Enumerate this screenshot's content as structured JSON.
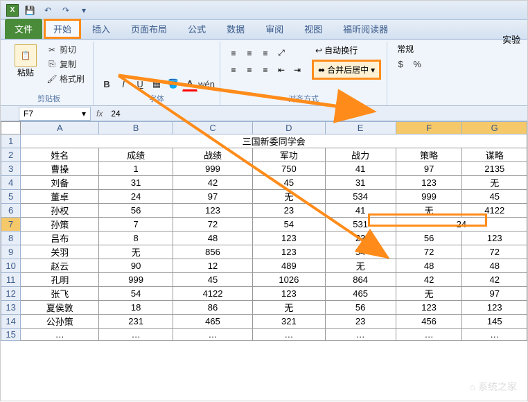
{
  "qat": {
    "app_icon": "X",
    "save": "💾",
    "undo": "↶",
    "redo": "↷"
  },
  "exp_label": "实验",
  "tabs": {
    "file": "文件",
    "home": "开始",
    "insert": "插入",
    "layout": "页面布局",
    "formula": "公式",
    "data": "数据",
    "review": "审阅",
    "view": "视图",
    "foxit": "福昕阅读器"
  },
  "ribbon": {
    "clipboard": {
      "paste": "粘贴",
      "cut": "剪切",
      "copy": "复制",
      "format_painter": "格式刷",
      "label": "剪贴板"
    },
    "font": {
      "label": "字体"
    },
    "align": {
      "wrap": "自动换行",
      "merge": "合并后居中",
      "label": "对齐方式"
    },
    "number": {
      "general": "常规"
    }
  },
  "namebox": {
    "cell": "F7",
    "fx": "fx",
    "value": "24"
  },
  "columns": [
    "A",
    "B",
    "C",
    "D",
    "E",
    "F",
    "G"
  ],
  "title_row": "三国新委同学会",
  "headers": [
    "姓名",
    "成绩",
    "战绩",
    "军功",
    "战力",
    "策略",
    "谋略"
  ],
  "rows": [
    [
      "曹操",
      "1",
      "999",
      "750",
      "41",
      "97",
      "2135"
    ],
    [
      "刘备",
      "31",
      "42",
      "45",
      "31",
      "123",
      "无"
    ],
    [
      "董卓",
      "24",
      "97",
      "无",
      "534",
      "999",
      "45"
    ],
    [
      "孙权",
      "56",
      "123",
      "23",
      "41",
      "无",
      "4122"
    ],
    [
      "孙策",
      "7",
      "72",
      "54",
      "531",
      "24",
      ""
    ],
    [
      "吕布",
      "8",
      "48",
      "123",
      "23",
      "56",
      "123"
    ],
    [
      "关羽",
      "无",
      "856",
      "123",
      "54",
      "72",
      "72"
    ],
    [
      "赵云",
      "90",
      "12",
      "489",
      "无",
      "48",
      "48"
    ],
    [
      "孔明",
      "999",
      "45",
      "1026",
      "864",
      "42",
      "42"
    ],
    [
      "张飞",
      "54",
      "4122",
      "123",
      "465",
      "无",
      "97"
    ],
    [
      "夏侯敦",
      "18",
      "86",
      "无",
      "56",
      "123",
      "123"
    ],
    [
      "公孙策",
      "231",
      "465",
      "321",
      "23",
      "456",
      "145"
    ],
    [
      "…",
      "…",
      "…",
      "…",
      "…",
      "…",
      "…"
    ]
  ],
  "chart_data": {
    "type": "table",
    "title": "三国新委同学会",
    "columns": [
      "姓名",
      "成绩",
      "战绩",
      "军功",
      "战力",
      "策略",
      "谋略"
    ],
    "data": [
      {
        "姓名": "曹操",
        "成绩": 1,
        "战绩": 999,
        "军功": 750,
        "战力": 41,
        "策略": 97,
        "谋略": 2135
      },
      {
        "姓名": "刘备",
        "成绩": 31,
        "战绩": 42,
        "军功": 45,
        "战力": 31,
        "策略": 123,
        "谋略": "无"
      },
      {
        "姓名": "董卓",
        "成绩": 24,
        "战绩": 97,
        "军功": "无",
        "战力": 534,
        "策略": 999,
        "谋略": 45
      },
      {
        "姓名": "孙权",
        "成绩": 56,
        "战绩": 123,
        "军功": 23,
        "战力": 41,
        "策略": "无",
        "谋略": 4122
      },
      {
        "姓名": "孙策",
        "成绩": 7,
        "战绩": 72,
        "军功": 54,
        "战力": 531,
        "策略": 24,
        "谋略": 24
      },
      {
        "姓名": "吕布",
        "成绩": 8,
        "战绩": 48,
        "军功": 123,
        "战力": 23,
        "策略": 56,
        "谋略": 123
      },
      {
        "姓名": "关羽",
        "成绩": "无",
        "战绩": 856,
        "军功": 123,
        "战力": 54,
        "策略": 72,
        "谋略": 72
      },
      {
        "姓名": "赵云",
        "成绩": 90,
        "战绩": 12,
        "军功": 489,
        "战力": "无",
        "策略": 48,
        "谋略": 48
      },
      {
        "姓名": "孔明",
        "成绩": 999,
        "战绩": 45,
        "军功": 1026,
        "战力": 864,
        "策略": 42,
        "谋略": 42
      },
      {
        "姓名": "张飞",
        "成绩": 54,
        "战绩": 4122,
        "军功": 123,
        "战力": 465,
        "策略": "无",
        "谋略": 97
      },
      {
        "姓名": "夏侯敦",
        "成绩": 18,
        "战绩": 86,
        "军功": "无",
        "战力": 56,
        "策略": 123,
        "谋略": 123
      },
      {
        "姓名": "公孙策",
        "成绩": 231,
        "战绩": 465,
        "军功": 321,
        "战力": 23,
        "策略": 456,
        "谋略": 145
      }
    ]
  },
  "watermark": "系统之家"
}
